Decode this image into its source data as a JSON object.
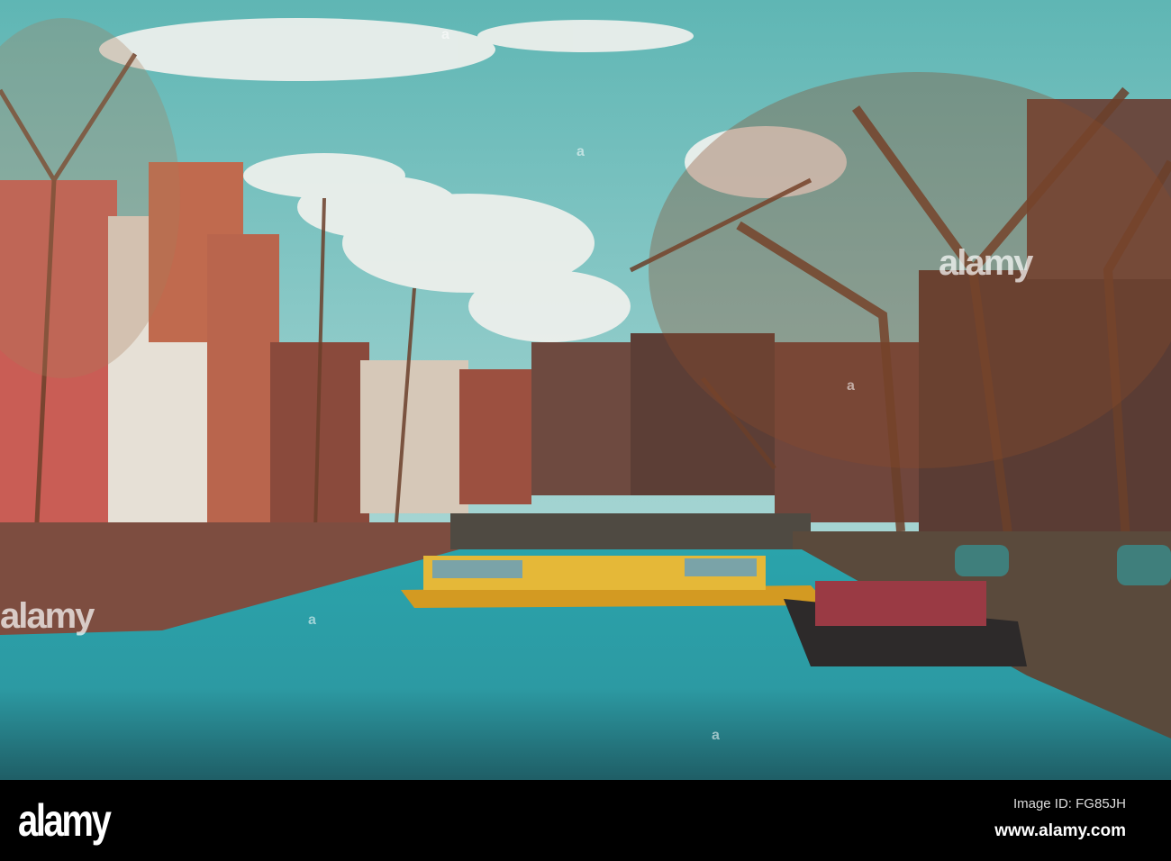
{
  "photo": {
    "subject": "canal-scene",
    "colors": {
      "sky": "#6fbfbf",
      "water": "#2fa6ad",
      "boat": "#e0b030",
      "brick": "#c0564a"
    }
  },
  "watermark": {
    "logo": "alamy",
    "mark": "a"
  },
  "footer": {
    "logo": "alamy",
    "image_id": "Image ID: FG85JH",
    "url": "www.alamy.com"
  }
}
